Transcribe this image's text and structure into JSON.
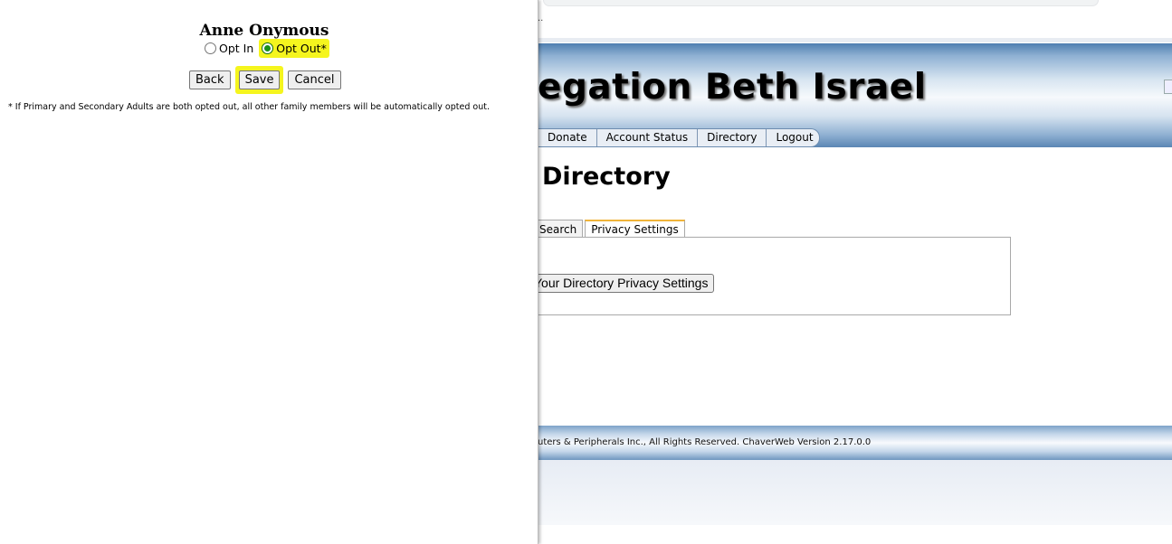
{
  "background": {
    "url_fragment": "..",
    "site_title": "egation Beth Israel",
    "nav": [
      "Donate",
      "Account Status",
      "Directory",
      "Logout"
    ],
    "page_heading": "Directory",
    "tabs": [
      "Search",
      "Privacy Settings"
    ],
    "privacy_button": "Your Directory Privacy Settings",
    "footer": "uters & Peripherals Inc., All Rights Reserved. ChaverWeb Version 2.17.0.0"
  },
  "modal": {
    "person_name": "Anne Onymous",
    "opt_in_label": "Opt In",
    "opt_out_label": "Opt Out*",
    "selected": "opt_out",
    "buttons": {
      "back": "Back",
      "save": "Save",
      "cancel": "Cancel"
    },
    "footnote": "* If Primary and Secondary Adults are both opted out, all other family members will be automatically opted out."
  },
  "colors": {
    "highlight": "#f5f51e",
    "banner_blue": "#4f7fb0",
    "tab_accent": "#f0b43a"
  }
}
